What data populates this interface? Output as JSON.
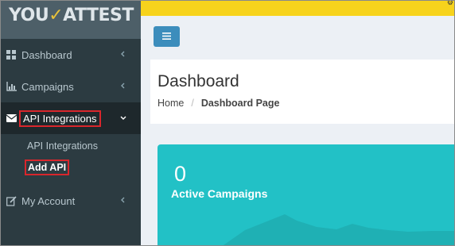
{
  "brand": {
    "logo_prefix": "YOU",
    "logo_suffix": "ATTEST"
  },
  "sidebar": {
    "items": [
      {
        "label": "Dashboard",
        "icon": "dashboard-icon"
      },
      {
        "label": "Campaigns",
        "icon": "bar-chart-icon"
      },
      {
        "label": "API Integrations",
        "icon": "envelope-icon"
      },
      {
        "label": "My Account",
        "icon": "edit-icon"
      }
    ],
    "submenu": [
      {
        "label": "API Integrations"
      },
      {
        "label": "Add API"
      }
    ]
  },
  "header": {
    "title": "Dashboard",
    "breadcrumb_home": "Home",
    "breadcrumb_current": "Dashboard Page"
  },
  "card": {
    "value": "0",
    "label": "Active Campaigns"
  },
  "colors": {
    "sidebar": "#2c3b41",
    "topbar": "#f7d31c",
    "toggle": "#3c8dbc",
    "card": "#22c1c6",
    "highlight": "#d9262c"
  }
}
